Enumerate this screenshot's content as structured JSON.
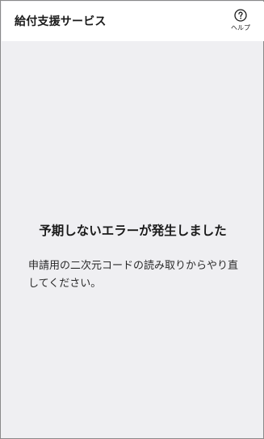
{
  "header": {
    "title": "給付支援サービス",
    "help_label": "ヘルプ",
    "help_icon": "question-circle-icon"
  },
  "error": {
    "title": "予期しないエラーが発生しました",
    "message": "申請用の二次元コードの読み取りからやり直してください。"
  },
  "colors": {
    "header_background": "#ffffff",
    "content_background": "#efeff2",
    "text": "#1a1a1a"
  }
}
